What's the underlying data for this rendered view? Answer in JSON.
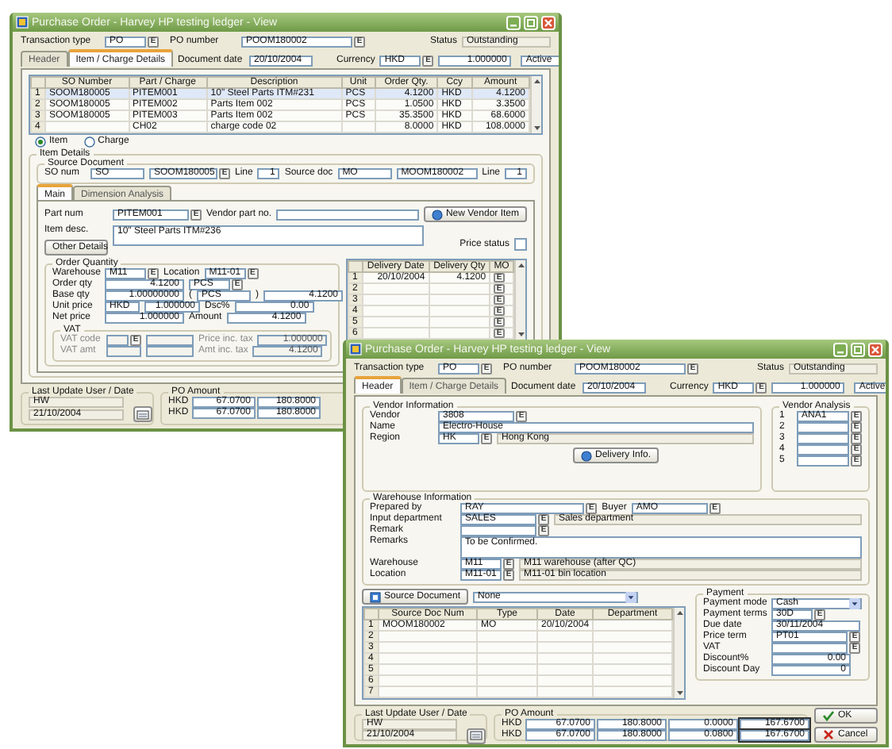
{
  "back_window": {
    "title": "Purchase Order - Harvey HP testing ledger - View",
    "header": {
      "transaction_type": {
        "label": "Transaction type",
        "value": "PO",
        "lookup": "E"
      },
      "po_number": {
        "label": "PO number",
        "value": "POOM180002",
        "lookup": "E"
      },
      "status": {
        "label": "Status",
        "value": "Outstanding"
      },
      "document_date": {
        "label": "Document date",
        "value": "20/10/2004"
      },
      "currency": {
        "label": "Currency",
        "value": "HKD",
        "lookup": "E",
        "rate": "1.000000"
      },
      "record_state": "Active"
    },
    "tabs": [
      {
        "label": "Header",
        "selected": false
      },
      {
        "label": "Item / Charge Details",
        "selected": true
      }
    ],
    "lines": {
      "columns": [
        "SO Number",
        "Part / Charge",
        "Description",
        "Unit",
        "Order Qty.",
        "Ccy",
        "Amount"
      ],
      "rows": [
        {
          "no": "1",
          "so_number": "SOOM180005",
          "part": "PITEM001",
          "description": "10\" Steel Parts ITM#231",
          "unit": "PCS",
          "qty": "4.1200",
          "ccy": "HKD",
          "amount": "4.1200",
          "selected": true
        },
        {
          "no": "2",
          "so_number": "SOOM180005",
          "part": "PITEM002",
          "description": "Parts Item 002",
          "unit": "PCS",
          "qty": "1.0500",
          "ccy": "HKD",
          "amount": "3.3500",
          "selected": false
        },
        {
          "no": "3",
          "so_number": "SOOM180005",
          "part": "PITEM003",
          "description": "Parts Item 002",
          "unit": "PCS",
          "qty": "35.3500",
          "ccy": "HKD",
          "amount": "68.6000",
          "selected": false
        },
        {
          "no": "4",
          "part": "CH02",
          "description": "charge code 02",
          "qty": "8.0000",
          "ccy": "HKD",
          "amount": "108.0000",
          "selected": false
        }
      ]
    },
    "line_type": [
      {
        "label": "Item",
        "selected": true
      },
      {
        "label": "Charge",
        "selected": false
      }
    ],
    "item_details": {
      "title": "Item Details",
      "source_title": "Source Document",
      "source_row": [
        {
          "kind": "label",
          "text": "SO num"
        },
        {
          "kind": "code",
          "value": "SO"
        },
        {
          "kind": "long",
          "value": "SOOM180005",
          "lookup": "E"
        },
        {
          "kind": "label",
          "text": "Line"
        },
        {
          "kind": "tiny",
          "value": "1"
        },
        {
          "kind": "label",
          "text": "Source doc"
        },
        {
          "kind": "code",
          "value": "MO"
        },
        {
          "kind": "long",
          "value": "MOOM180002"
        },
        {
          "kind": "label",
          "text": "Line"
        },
        {
          "kind": "tiny",
          "value": "1"
        }
      ]
    },
    "detail_tabs": [
      {
        "label": "Main",
        "selected": true
      },
      {
        "label": "Dimension Analysis",
        "selected": false
      }
    ],
    "part_row": [
      {
        "kind": "label",
        "text": "Part num"
      },
      {
        "kind": "field",
        "value": "PITEM001",
        "lookup": "E"
      },
      {
        "kind": "label",
        "text": "Vendor part no."
      },
      {
        "kind": "long"
      }
    ],
    "new_vendor_item": "New Vendor Item",
    "item_desc": {
      "label": "Item desc.",
      "value": "10\" Steel Parts ITM#236"
    },
    "other_details": "Other Details",
    "price_status": {
      "label": "Price status",
      "checked": false
    },
    "order_quantity": {
      "title": "Order Quantity",
      "rows": [
        [
          {
            "kind": "label",
            "text": "Warehouse"
          },
          {
            "kind": "code",
            "value": "M11",
            "lookup": "E"
          },
          {
            "kind": "label",
            "text": "Location"
          },
          {
            "kind": "code",
            "value": "M11-01",
            "lookup": "E"
          }
        ],
        [
          {
            "kind": "label",
            "text": "Order qty"
          },
          {
            "kind": "number",
            "value": "4.1200"
          },
          {
            "kind": "code",
            "value": "PCS",
            "lookup": "E"
          }
        ],
        [
          {
            "kind": "label",
            "text": "Base qty"
          },
          {
            "kind": "number",
            "value": "1.00000000"
          },
          {
            "kind": "text",
            "text": "("
          },
          {
            "kind": "code",
            "value": "PCS"
          },
          {
            "kind": "text",
            "text": ")"
          },
          {
            "kind": "number",
            "value": "4.1200"
          }
        ],
        [
          {
            "kind": "label",
            "text": "Unit price"
          },
          {
            "kind": "code",
            "value": "HKD"
          },
          {
            "kind": "number",
            "value": "1.000000"
          },
          {
            "kind": "label",
            "text": "Dsc%"
          },
          {
            "kind": "number",
            "value": "0.00"
          }
        ],
        [
          {
            "kind": "label",
            "text": "Net price"
          },
          {
            "kind": "number",
            "value": "1.000000"
          },
          {
            "kind": "label",
            "text": "Amount"
          },
          {
            "kind": "number",
            "value": "4.1200"
          }
        ]
      ]
    },
    "vat": {
      "title": "VAT",
      "disabled": true,
      "rows": [
        [
          {
            "kind": "label",
            "text": "VAT code"
          },
          {
            "kind": "tiny",
            "lookup": "E"
          },
          {
            "kind": "field"
          },
          {
            "kind": "label",
            "text": "Price inc. tax"
          },
          {
            "kind": "number",
            "value": "1.000000"
          }
        ],
        [
          {
            "kind": "label",
            "text": "VAT amt"
          },
          {
            "kind": "tiny"
          },
          {
            "kind": "field"
          },
          {
            "kind": "label",
            "text": "Amt inc. tax"
          },
          {
            "kind": "number",
            "value": "4.1200"
          }
        ]
      ]
    },
    "delivery": {
      "columns": [
        "Delivery Date",
        "Delivery Qty",
        "MO"
      ],
      "rows": [
        {
          "no": "1",
          "date": "20/10/2004",
          "qty": "4.1200",
          "lookup": "E"
        },
        {
          "no": "2",
          "lookup": "E"
        },
        {
          "no": "3",
          "lookup": "E"
        },
        {
          "no": "4",
          "lookup": "E"
        },
        {
          "no": "5",
          "lookup": "E"
        },
        {
          "no": "6",
          "lookup": "E"
        }
      ]
    },
    "footer": {
      "last_update_title": "Last Update User / Date",
      "user": "HW",
      "date": "21/10/2004",
      "po_amount_title": "PO Amount",
      "amounts": [
        [
          "HKD",
          "67.0700",
          "180.8000"
        ],
        [
          "HKD",
          "67.0700",
          "180.8000"
        ]
      ]
    }
  },
  "front_window": {
    "title": "Purchase Order - Harvey HP testing ledger - View",
    "header": {
      "transaction_type": {
        "label": "Transaction type",
        "value": "PO",
        "lookup": "E"
      },
      "po_number": {
        "label": "PO number",
        "value": "POOM180002",
        "lookup": "E"
      },
      "status": {
        "label": "Status",
        "value": "Outstanding"
      },
      "document_date": {
        "label": "Document date",
        "value": "20/10/2004"
      },
      "currency": {
        "label": "Currency",
        "value": "HKD",
        "lookup": "E",
        "rate": "1.000000"
      },
      "record_state": "Active"
    },
    "tabs": [
      {
        "label": "Header",
        "selected": true
      },
      {
        "label": "Item / Charge Details",
        "selected": false
      }
    ],
    "vendor": {
      "title": "Vendor Information",
      "rows": [
        [
          {
            "kind": "label",
            "text": "Vendor"
          },
          {
            "kind": "field",
            "value": "3808",
            "lookup": "E"
          }
        ],
        [
          {
            "kind": "label",
            "text": "Name"
          },
          {
            "kind": "long",
            "value": "Electro-House"
          }
        ],
        [
          {
            "kind": "label",
            "text": "Region"
          },
          {
            "kind": "code",
            "value": "HK",
            "lookup": "E"
          },
          {
            "kind": "display",
            "value": "Hong Kong"
          }
        ]
      ],
      "delivery_button": "Delivery Info."
    },
    "vendor_analysis": {
      "title": "Vendor Analysis",
      "rows": [
        {
          "no": "1",
          "value": "ANA1",
          "lookup": "E"
        },
        {
          "no": "2",
          "lookup": "E"
        },
        {
          "no": "3",
          "lookup": "E"
        },
        {
          "no": "4",
          "lookup": "E"
        },
        {
          "no": "5",
          "lookup": "E"
        }
      ]
    },
    "warehouse": {
      "title": "Warehouse Information",
      "rows": [
        [
          {
            "kind": "label",
            "text": "Prepared by"
          },
          {
            "kind": "long",
            "value": "RAY",
            "lookup": "E"
          },
          {
            "kind": "label",
            "text": "Buyer"
          },
          {
            "kind": "field",
            "value": "AMO",
            "lookup": "E"
          },
          {
            "kind": "gap"
          }
        ],
        [
          {
            "kind": "label",
            "text": "Input department"
          },
          {
            "kind": "field",
            "value": "SALES",
            "lookup": "E"
          },
          {
            "kind": "display",
            "value": "Sales department"
          }
        ],
        [
          {
            "kind": "label",
            "text": "Remark"
          },
          {
            "kind": "field",
            "lookup": "E"
          }
        ],
        [
          {
            "kind": "label",
            "text": "Remarks"
          },
          {
            "kind": "memo",
            "value": "To be Confirmed."
          }
        ],
        [
          {
            "kind": "label",
            "text": "Warehouse"
          },
          {
            "kind": "code",
            "value": "M11",
            "lookup": "E"
          },
          {
            "kind": "display",
            "value": "M11 warehouse (after QC)"
          }
        ],
        [
          {
            "kind": "label",
            "text": "Location"
          },
          {
            "kind": "code",
            "value": "M11-01",
            "lookup": "E"
          },
          {
            "kind": "display",
            "value": "M11-01 bin location"
          }
        ]
      ]
    },
    "source_docs": {
      "button": "Source Document",
      "filter": "None",
      "columns": [
        "Source Doc Num",
        "Type",
        "Date",
        "Department"
      ],
      "rows": [
        {
          "no": "1",
          "doc": "MOOM180002",
          "type": "MO",
          "date": "20/10/2004"
        },
        {
          "no": "2"
        },
        {
          "no": "3"
        },
        {
          "no": "4"
        },
        {
          "no": "5"
        },
        {
          "no": "6"
        },
        {
          "no": "7"
        }
      ]
    },
    "payment": {
      "title": "Payment",
      "rows": [
        [
          {
            "kind": "label",
            "text": "Payment mode"
          },
          {
            "kind": "select",
            "value": "Cash"
          }
        ],
        [
          {
            "kind": "label",
            "text": "Payment terms"
          },
          {
            "kind": "code",
            "value": "30D",
            "lookup": "E"
          }
        ],
        [
          {
            "kind": "label",
            "text": "Due date"
          },
          {
            "kind": "field",
            "value": "30/11/2004"
          }
        ],
        [
          {
            "kind": "label",
            "text": "Price term"
          },
          {
            "kind": "field",
            "value": "PT01",
            "lookup": "E"
          }
        ],
        [
          {
            "kind": "label",
            "text": "VAT"
          },
          {
            "kind": "field",
            "lookup": "E"
          }
        ],
        [
          {
            "kind": "label",
            "text": "Discount%"
          },
          {
            "kind": "number",
            "value": "0.00"
          }
        ],
        [
          {
            "kind": "label",
            "text": "Discount Day"
          },
          {
            "kind": "number",
            "value": "0"
          }
        ]
      ]
    },
    "footer": {
      "last_update_title": "Last Update User / Date",
      "user": "HW",
      "date": "21/10/2004",
      "po_amount_title": "PO Amount",
      "amounts": [
        [
          "HKD",
          "67.0700",
          "180.8000",
          "0.0000",
          "167.6700"
        ],
        [
          "HKD",
          "67.0700",
          "180.8000",
          "0.0800",
          "167.6700"
        ]
      ]
    },
    "actions": [
      {
        "kind": "ok",
        "label": "OK"
      },
      {
        "kind": "cancel",
        "label": "Cancel"
      }
    ]
  }
}
